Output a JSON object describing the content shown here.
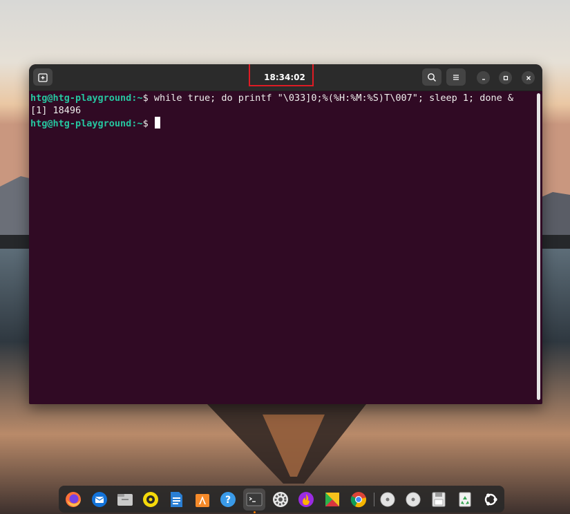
{
  "window": {
    "title": "18:34:02",
    "buttons": {
      "new_tab_icon": "new-tab-icon",
      "search_icon": "search-icon",
      "menu_icon": "hamburger-menu-icon",
      "minimize_icon": "minimize-icon",
      "maximize_icon": "maximize-icon",
      "close_icon": "close-icon"
    },
    "highlight_color": "#e01b24"
  },
  "terminal": {
    "background": "#300a24",
    "prompt_color": "#26c6a0",
    "line1": {
      "prompt": "htg@htg-playground:~",
      "symbol": "$ ",
      "command": "while true; do printf \"\\033]0;%(%H:%M:%S)T\\007\"; sleep 1; done &"
    },
    "line2": {
      "output": "[1] 18496"
    },
    "line3": {
      "prompt": "htg@htg-playground:~",
      "symbol": "$ "
    }
  },
  "dock": {
    "items": [
      {
        "name": "firefox-icon"
      },
      {
        "name": "thunderbird-icon"
      },
      {
        "name": "files-icon"
      },
      {
        "name": "rhythmbox-icon"
      },
      {
        "name": "writer-icon"
      },
      {
        "name": "app-center-icon"
      },
      {
        "name": "help-icon"
      },
      {
        "name": "terminal-icon",
        "active": true
      },
      {
        "name": "settings-icon"
      },
      {
        "name": "app-icon"
      },
      {
        "name": "tiles-app-icon"
      },
      {
        "name": "chrome-icon"
      },
      {
        "name": "disc-icon"
      },
      {
        "name": "disc-icon"
      },
      {
        "name": "save-icon"
      },
      {
        "name": "trash-icon"
      },
      {
        "name": "ubuntu-icon"
      }
    ]
  }
}
